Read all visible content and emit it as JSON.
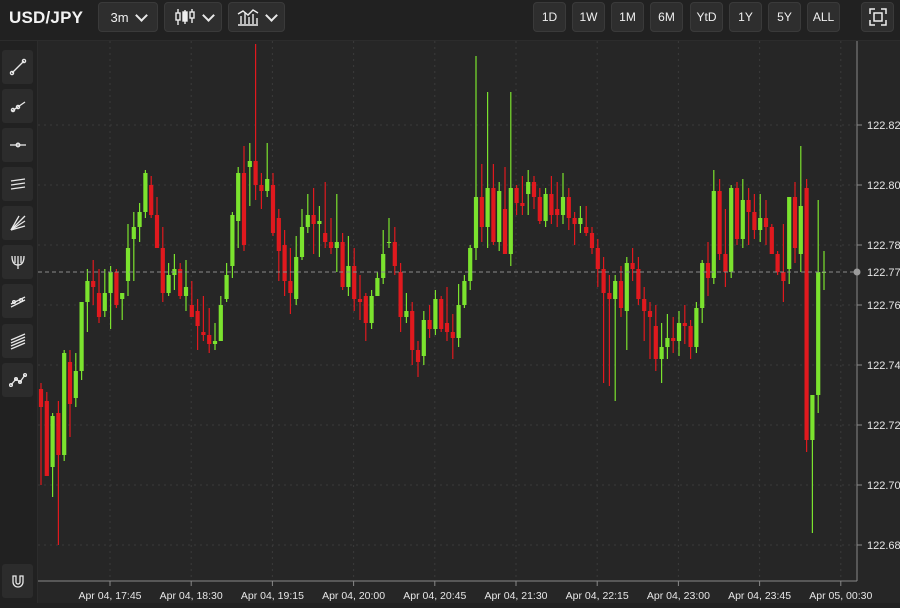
{
  "header": {
    "symbol": "USD/JPY",
    "interval_label": "3m",
    "chart_type_icon": "candlestick-icon",
    "indicator_icon": "indicators-icon",
    "ranges": [
      "1D",
      "1W",
      "1M",
      "6M",
      "YtD",
      "1Y",
      "5Y",
      "ALL"
    ],
    "fullscreen_icon": "fullscreen-icon"
  },
  "tools": [
    "trend-line-icon",
    "ray-line-icon",
    "horizontal-line-icon",
    "parallel-channel-icon",
    "fan-icon",
    "pitchfork-icon",
    "regression-channel-icon",
    "multi-line-channel-icon",
    "polyline-icon",
    "magnet-icon"
  ],
  "colors": {
    "up": "#7be32e",
    "down": "#e0191e",
    "background": "#262626",
    "grid": "#3a3a3a",
    "crosshair": "#8a8a8a"
  },
  "chart_data": {
    "type": "candlestick",
    "x_ticks": [
      "Apr 04, 17:45",
      "Apr 04, 18:30",
      "Apr 04, 19:15",
      "Apr 04, 20:00",
      "Apr 04, 20:45",
      "Apr 04, 21:30",
      "Apr 04, 22:15",
      "Apr 04, 23:00",
      "Apr 04, 23:45",
      "Apr 05, 00:30"
    ],
    "y_ticks": [
      "122.82",
      "122.80",
      "122.78",
      "122.76",
      "122.74",
      "122.72",
      "122.70",
      "122.68"
    ],
    "ylim": [
      122.668,
      122.848
    ],
    "current_price": 122.771,
    "current_price_label": "122.77",
    "grid": true,
    "candles": [
      [
        122.732,
        122.734,
        122.7,
        122.726
      ],
      [
        122.728,
        122.731,
        122.703,
        122.703
      ],
      [
        122.706,
        122.724,
        122.696,
        122.723
      ],
      [
        122.724,
        122.728,
        122.68,
        122.71
      ],
      [
        122.71,
        122.745,
        122.708,
        122.744
      ],
      [
        122.741,
        122.745,
        122.716,
        122.727
      ],
      [
        122.729,
        122.744,
        122.726,
        122.738
      ],
      [
        122.738,
        122.761,
        122.735,
        122.761
      ],
      [
        122.761,
        122.772,
        122.751,
        122.768
      ],
      [
        122.768,
        122.775,
        122.76,
        122.766
      ],
      [
        122.764,
        122.772,
        122.754,
        122.756
      ],
      [
        122.758,
        122.772,
        122.756,
        122.764
      ],
      [
        122.764,
        122.773,
        122.752,
        122.771
      ],
      [
        122.771,
        122.772,
        122.759,
        122.76
      ],
      [
        122.762,
        122.764,
        122.755,
        122.764
      ],
      [
        122.768,
        122.787,
        122.763,
        122.779
      ],
      [
        122.782,
        122.791,
        122.768,
        122.786
      ],
      [
        122.786,
        122.794,
        122.781,
        122.791
      ],
      [
        122.791,
        122.805,
        122.789,
        122.804
      ],
      [
        122.8,
        122.803,
        122.789,
        122.79
      ],
      [
        122.79,
        122.796,
        122.779,
        122.779
      ],
      [
        122.779,
        122.786,
        122.761,
        122.764
      ],
      [
        122.764,
        122.774,
        122.763,
        122.77
      ],
      [
        122.77,
        122.777,
        122.765,
        122.772
      ],
      [
        122.772,
        122.774,
        122.762,
        122.763
      ],
      [
        122.763,
        122.775,
        122.758,
        122.766
      ],
      [
        122.76,
        122.768,
        122.756,
        122.756
      ],
      [
        122.758,
        122.762,
        122.745,
        122.753
      ],
      [
        122.751,
        122.763,
        122.748,
        122.75
      ],
      [
        122.75,
        122.759,
        122.744,
        122.747
      ],
      [
        122.747,
        122.754,
        122.745,
        122.748
      ],
      [
        122.748,
        122.763,
        122.748,
        122.76
      ],
      [
        122.762,
        122.774,
        122.761,
        122.77
      ],
      [
        122.773,
        122.791,
        122.769,
        122.79
      ],
      [
        122.788,
        122.806,
        122.779,
        122.804
      ],
      [
        122.804,
        122.813,
        122.778,
        122.78
      ],
      [
        122.806,
        122.814,
        122.793,
        122.808
      ],
      [
        122.808,
        122.847,
        122.795,
        122.8
      ],
      [
        122.8,
        122.804,
        122.792,
        122.798
      ],
      [
        122.798,
        122.814,
        122.796,
        122.802
      ],
      [
        122.8,
        122.804,
        122.783,
        122.784
      ],
      [
        122.789,
        122.792,
        122.768,
        122.778
      ],
      [
        122.78,
        122.785,
        122.763,
        122.768
      ],
      [
        122.768,
        122.779,
        122.757,
        122.764
      ],
      [
        122.762,
        122.783,
        122.76,
        122.776
      ],
      [
        122.776,
        122.792,
        122.775,
        122.786
      ],
      [
        122.786,
        122.797,
        122.784,
        122.79
      ],
      [
        122.79,
        122.799,
        122.777,
        122.787
      ],
      [
        122.787,
        122.793,
        122.776,
        122.788
      ],
      [
        122.784,
        122.801,
        122.779,
        122.781
      ],
      [
        122.781,
        122.789,
        122.777,
        122.779
      ],
      [
        122.779,
        122.797,
        122.771,
        122.781
      ],
      [
        122.781,
        122.784,
        122.765,
        122.766
      ],
      [
        122.766,
        122.783,
        122.763,
        122.773
      ],
      [
        122.773,
        122.779,
        122.758,
        122.762
      ],
      [
        122.762,
        122.77,
        122.755,
        122.761
      ],
      [
        122.763,
        122.764,
        122.748,
        122.754
      ],
      [
        122.754,
        122.765,
        122.752,
        122.763
      ],
      [
        122.763,
        122.771,
        122.763,
        122.769
      ],
      [
        122.769,
        122.785,
        122.767,
        122.777
      ],
      [
        122.781,
        122.789,
        122.779,
        122.781
      ],
      [
        122.781,
        122.786,
        122.77,
        122.773
      ],
      [
        122.771,
        122.774,
        122.751,
        122.756
      ],
      [
        122.756,
        122.764,
        122.754,
        122.758
      ],
      [
        122.758,
        122.761,
        122.74,
        122.745
      ],
      [
        122.745,
        122.748,
        122.736,
        122.741
      ],
      [
        122.743,
        122.758,
        122.74,
        122.755
      ],
      [
        122.755,
        122.76,
        122.749,
        122.752
      ],
      [
        122.752,
        122.765,
        122.75,
        122.762
      ],
      [
        122.762,
        122.763,
        122.751,
        122.752
      ],
      [
        122.754,
        122.766,
        122.748,
        122.751
      ],
      [
        122.751,
        122.757,
        122.742,
        122.749
      ],
      [
        122.749,
        122.767,
        122.746,
        122.76
      ],
      [
        122.76,
        122.77,
        122.759,
        122.768
      ],
      [
        122.768,
        122.78,
        122.765,
        122.779
      ],
      [
        122.779,
        122.843,
        122.775,
        122.796
      ],
      [
        122.796,
        122.807,
        122.781,
        122.786
      ],
      [
        122.786,
        122.831,
        122.779,
        122.799
      ],
      [
        122.799,
        122.807,
        122.78,
        122.781
      ],
      [
        122.781,
        122.801,
        122.778,
        122.798
      ],
      [
        122.792,
        122.806,
        122.777,
        122.777
      ],
      [
        122.777,
        122.831,
        122.773,
        122.799
      ],
      [
        122.799,
        122.8,
        122.79,
        122.794
      ],
      [
        122.794,
        122.803,
        122.79,
        122.793
      ],
      [
        122.797,
        122.805,
        122.79,
        122.801
      ],
      [
        122.801,
        122.803,
        122.792,
        122.796
      ],
      [
        122.796,
        122.799,
        122.787,
        122.788
      ],
      [
        122.788,
        122.799,
        122.786,
        122.797
      ],
      [
        122.797,
        122.803,
        122.787,
        122.79
      ],
      [
        122.792,
        122.801,
        122.786,
        122.79
      ],
      [
        122.79,
        122.804,
        122.787,
        122.796
      ],
      [
        122.796,
        122.799,
        122.785,
        122.789
      ],
      [
        122.789,
        122.791,
        122.78,
        122.787
      ],
      [
        122.787,
        122.793,
        122.784,
        122.789
      ],
      [
        122.786,
        122.793,
        122.783,
        122.784
      ],
      [
        122.784,
        122.786,
        122.777,
        122.779
      ],
      [
        122.779,
        122.782,
        122.766,
        122.772
      ],
      [
        122.772,
        122.776,
        122.734,
        122.764
      ],
      [
        122.764,
        122.77,
        122.733,
        122.762
      ],
      [
        122.762,
        122.77,
        122.728,
        122.768
      ],
      [
        122.768,
        122.773,
        122.756,
        122.759
      ],
      [
        122.758,
        122.776,
        122.745,
        122.774
      ],
      [
        122.774,
        122.779,
        122.768,
        122.772
      ],
      [
        122.772,
        122.776,
        122.76,
        122.762
      ],
      [
        122.762,
        122.766,
        122.748,
        122.758
      ],
      [
        122.758,
        122.761,
        122.742,
        122.756
      ],
      [
        122.753,
        122.76,
        122.738,
        122.742
      ],
      [
        122.742,
        122.754,
        122.734,
        122.746
      ],
      [
        122.746,
        122.757,
        122.742,
        122.749
      ],
      [
        122.749,
        122.756,
        122.744,
        122.748
      ],
      [
        122.748,
        122.758,
        122.743,
        122.754
      ],
      [
        122.754,
        122.76,
        122.747,
        122.753
      ],
      [
        122.753,
        122.755,
        122.742,
        122.746
      ],
      [
        122.746,
        122.761,
        122.744,
        122.759
      ],
      [
        122.759,
        122.775,
        122.754,
        122.774
      ],
      [
        122.774,
        122.781,
        122.763,
        122.769
      ],
      [
        122.769,
        122.805,
        122.767,
        122.798
      ],
      [
        122.798,
        122.802,
        122.775,
        122.777
      ],
      [
        122.777,
        122.792,
        122.766,
        122.771
      ],
      [
        122.771,
        122.8,
        122.769,
        122.799
      ],
      [
        122.799,
        122.801,
        122.78,
        122.782
      ],
      [
        122.782,
        122.802,
        122.779,
        122.795
      ],
      [
        122.795,
        122.799,
        122.78,
        122.791
      ],
      [
        122.791,
        122.797,
        122.782,
        122.785
      ],
      [
        122.785,
        122.797,
        122.781,
        122.789
      ],
      [
        122.789,
        122.795,
        122.78,
        122.786
      ],
      [
        122.786,
        122.787,
        122.777,
        122.777
      ],
      [
        122.777,
        122.778,
        122.77,
        122.771
      ],
      [
        122.771,
        122.787,
        122.761,
        122.768
      ],
      [
        122.772,
        122.796,
        122.767,
        122.796
      ],
      [
        122.796,
        122.801,
        122.774,
        122.779
      ],
      [
        122.777,
        122.813,
        122.771,
        122.793
      ],
      [
        122.799,
        122.802,
        122.711,
        122.715
      ],
      [
        122.715,
        122.725,
        122.684,
        122.73
      ],
      [
        122.73,
        122.795,
        122.724,
        122.771
      ],
      [
        122.771,
        122.778,
        122.765,
        122.771
      ]
    ]
  }
}
